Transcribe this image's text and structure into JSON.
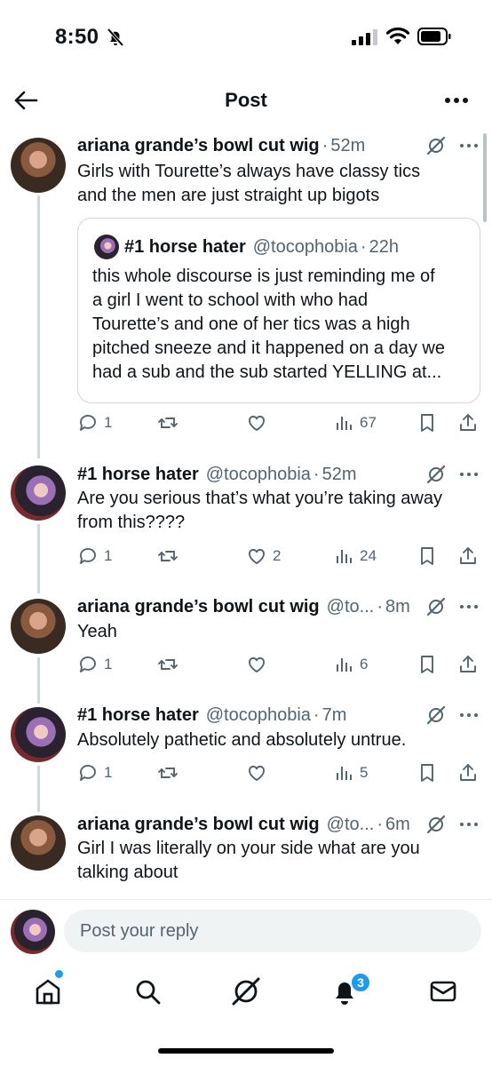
{
  "status_bar": {
    "time": "8:50"
  },
  "header": {
    "title": "Post"
  },
  "posts": [
    {
      "author": "ariana grande’s bowl cut wig",
      "handle": "",
      "time": "52m",
      "text_lines": [
        "Girls with Tourette’s always have classy tics",
        "and the men are just straight up bigots"
      ],
      "quote": {
        "author": "#1 horse hater",
        "handle": "@tocophobia",
        "time": "22h",
        "text_lines": [
          "this whole discourse is just reminding me of",
          "a girl I went to school with who had",
          "Tourette’s and one of her tics was a high",
          "pitched sneeze and it happened on a day we",
          "had a sub and the sub started YELLING at..."
        ]
      },
      "replies": "1",
      "reposts": "",
      "likes": "",
      "views": "67"
    },
    {
      "author": "#1 horse hater",
      "handle": "@tocophobia",
      "time": "52m",
      "text_lines": [
        "Are you serious that’s what you’re taking away",
        "from this????"
      ],
      "replies": "1",
      "reposts": "",
      "likes": "2",
      "views": "24"
    },
    {
      "author": "ariana grande’s bowl cut wig",
      "handle": "@to...",
      "time": "8m",
      "text_lines": [
        "Yeah"
      ],
      "replies": "1",
      "reposts": "",
      "likes": "",
      "views": "6"
    },
    {
      "author": "#1 horse hater",
      "handle": "@tocophobia",
      "time": "7m",
      "text_lines": [
        "Absolutely pathetic and absolutely untrue."
      ],
      "replies": "1",
      "reposts": "",
      "likes": "",
      "views": "5"
    },
    {
      "author": "ariana grande’s bowl cut wig",
      "handle": "@to...",
      "time": "6m",
      "text_lines": [
        "Girl I was literally on your side what are you",
        "talking about"
      ]
    }
  ],
  "reply_bar": {
    "placeholder": "Post your reply"
  },
  "tabbar": {
    "notifications_badge": "3"
  },
  "colors": {
    "accent": "#1d9bf0",
    "muted": "#536471",
    "text": "#0f1419"
  },
  "icons": [
    "back-arrow-icon",
    "more-icon",
    "grok-icon",
    "reply-icon",
    "repost-icon",
    "like-icon",
    "views-icon",
    "bookmark-icon",
    "share-icon",
    "home-icon",
    "search-icon",
    "grok-tab-icon",
    "bell-icon",
    "mail-icon"
  ]
}
